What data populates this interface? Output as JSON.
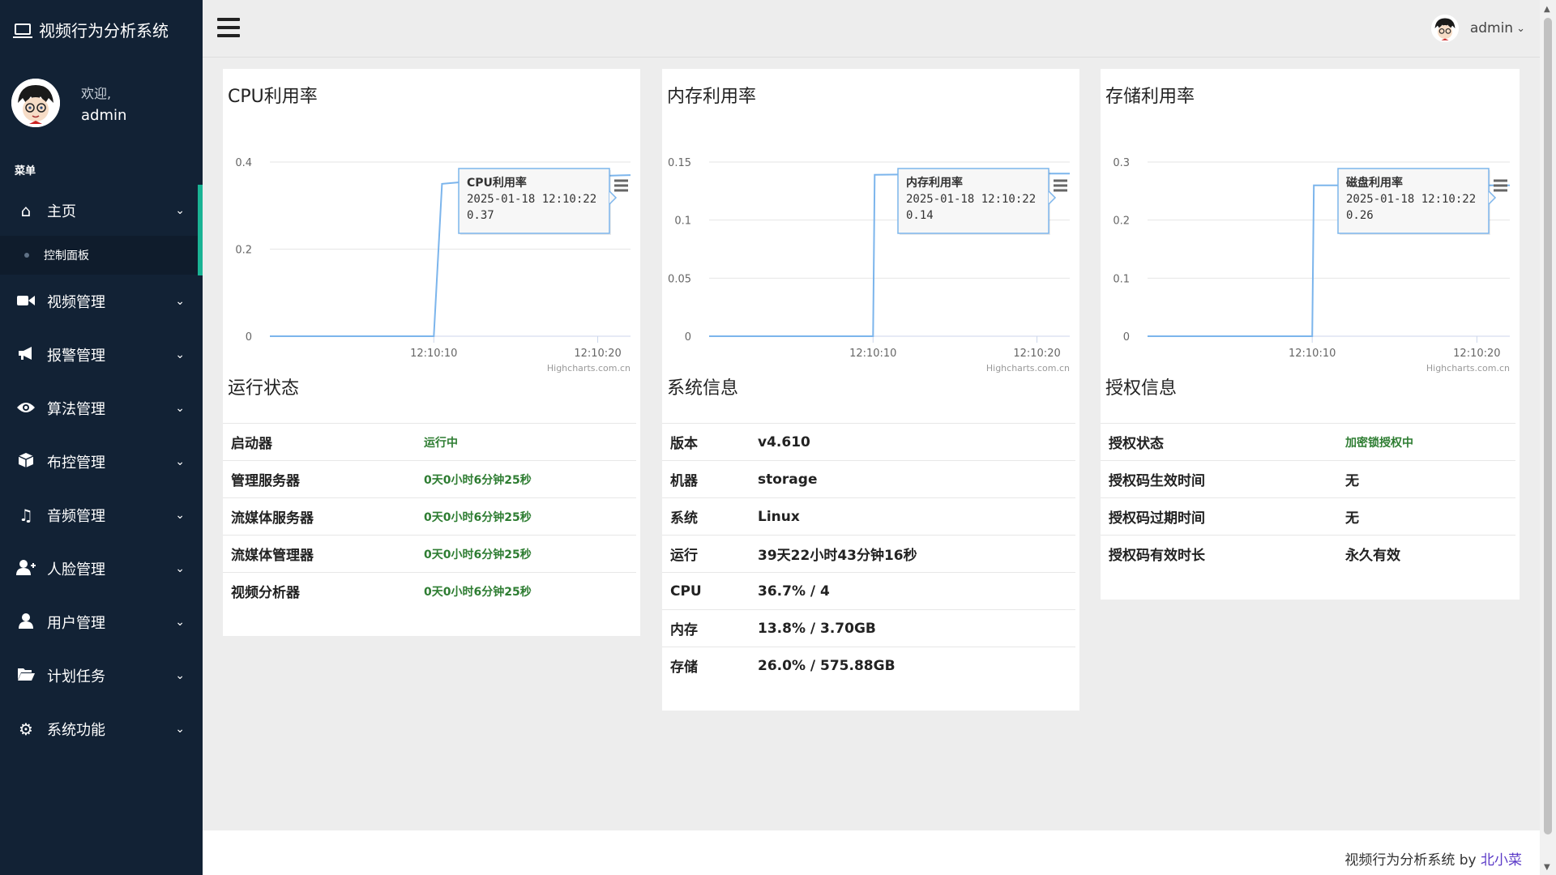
{
  "app": {
    "title": "视频行为分析系统"
  },
  "profile": {
    "welcome": "欢迎,",
    "name": "admin"
  },
  "menu": {
    "heading": "菜单",
    "items": [
      {
        "label": "主页",
        "icon": "home-icon"
      },
      {
        "label": "视频管理",
        "icon": "video-camera-icon"
      },
      {
        "label": "报警管理",
        "icon": "megaphone-icon"
      },
      {
        "label": "算法管理",
        "icon": "eye-icon"
      },
      {
        "label": "布控管理",
        "icon": "cube-icon"
      },
      {
        "label": "音频管理",
        "icon": "music-icon"
      },
      {
        "label": "人脸管理",
        "icon": "user-plus-icon"
      },
      {
        "label": "用户管理",
        "icon": "user-icon"
      },
      {
        "label": "计划任务",
        "icon": "folder-open-icon"
      },
      {
        "label": "系统功能",
        "icon": "gear-icon"
      }
    ],
    "sub_active": "控制面板"
  },
  "topbar": {
    "user": "admin"
  },
  "charts": {
    "cpu": {
      "title": "CPU利用率"
    },
    "mem": {
      "title": "内存利用率"
    },
    "disk": {
      "title": "存储利用率"
    },
    "credit": "Highcharts.com.cn"
  },
  "chart_data": [
    {
      "type": "line",
      "title": "CPU利用率",
      "xlabel": "",
      "ylabel": "",
      "x_ticks": [
        "12:10:10",
        "12:10:20"
      ],
      "y_ticks": [
        "0",
        "0.2",
        "0.4"
      ],
      "ylim": [
        0,
        0.4
      ],
      "xlim": [
        "12:10:00",
        "12:10:22"
      ],
      "series": [
        {
          "name": "CPU利用率",
          "x": [
            "12:10:00",
            "12:10:10",
            "12:10:10.5",
            "12:10:12",
            "12:10:14",
            "12:10:16",
            "12:10:18",
            "12:10:20",
            "12:10:22"
          ],
          "values": [
            0,
            0,
            0.35,
            0.355,
            0.36,
            0.363,
            0.366,
            0.368,
            0.37
          ]
        }
      ],
      "tooltip": {
        "name": "CPU利用率",
        "time": "2025-01-18 12:10:22",
        "value": "0.37"
      },
      "grid": true,
      "legend": "none"
    },
    {
      "type": "line",
      "title": "内存利用率",
      "xlabel": "",
      "ylabel": "",
      "x_ticks": [
        "12:10:10",
        "12:10:20"
      ],
      "y_ticks": [
        "0",
        "0.05",
        "0.1",
        "0.15"
      ],
      "ylim": [
        0,
        0.15
      ],
      "xlim": [
        "12:10:00",
        "12:10:22"
      ],
      "series": [
        {
          "name": "内存利用率",
          "x": [
            "12:10:00",
            "12:10:10",
            "12:10:10.1",
            "12:10:16",
            "12:10:22"
          ],
          "values": [
            0,
            0,
            0.139,
            0.14,
            0.14
          ]
        }
      ],
      "tooltip": {
        "name": "内存利用率",
        "time": "2025-01-18 12:10:22",
        "value": "0.14"
      },
      "grid": true,
      "legend": "none"
    },
    {
      "type": "line",
      "title": "存储利用率",
      "xlabel": "",
      "ylabel": "",
      "x_ticks": [
        "12:10:10",
        "12:10:20"
      ],
      "y_ticks": [
        "0",
        "0.1",
        "0.2",
        "0.3"
      ],
      "ylim": [
        0,
        0.3
      ],
      "xlim": [
        "12:10:00",
        "12:10:22"
      ],
      "series": [
        {
          "name": "磁盘利用率",
          "x": [
            "12:10:00",
            "12:10:10",
            "12:10:10.1",
            "12:10:16",
            "12:10:22"
          ],
          "values": [
            0,
            0,
            0.26,
            0.26,
            0.26
          ]
        }
      ],
      "tooltip": {
        "name": "磁盘利用率",
        "time": "2025-01-18 12:10:22",
        "value": "0.26"
      },
      "grid": true,
      "legend": "none"
    }
  ],
  "run_status": {
    "title": "运行状态",
    "rows": [
      {
        "k": "启动器",
        "v": "运行中"
      },
      {
        "k": "管理服务器",
        "v": "0天0小时6分钟25秒"
      },
      {
        "k": "流媒体服务器",
        "v": "0天0小时6分钟25秒"
      },
      {
        "k": "流媒体管理器",
        "v": "0天0小时6分钟25秒"
      },
      {
        "k": "视频分析器",
        "v": "0天0小时6分钟25秒"
      }
    ]
  },
  "sys_info": {
    "title": "系统信息",
    "rows": [
      {
        "k": "版本",
        "v": "v4.610"
      },
      {
        "k": "机器",
        "v": "storage"
      },
      {
        "k": "系统",
        "v": "Linux"
      },
      {
        "k": "运行",
        "v": "39天22小时43分钟16秒"
      },
      {
        "k": "CPU",
        "v": "36.7% / 4"
      },
      {
        "k": "内存",
        "v": "13.8% / 3.70GB"
      },
      {
        "k": "存储",
        "v": "26.0% / 575.88GB"
      }
    ]
  },
  "license": {
    "title": "授权信息",
    "rows": [
      {
        "k": "授权状态",
        "v": "加密锁授权中"
      },
      {
        "k": "授权码生效时间",
        "v": "无"
      },
      {
        "k": "授权码过期时间",
        "v": "无"
      },
      {
        "k": "授权码有效时长",
        "v": "永久有效"
      }
    ]
  },
  "footer": {
    "text": "视频行为分析系统 by ",
    "author": "北小菜"
  },
  "colors": {
    "sidebar": "#122235",
    "accent": "#1ab394",
    "line": "#7cb5ec",
    "status_green": "#2e7d32"
  }
}
